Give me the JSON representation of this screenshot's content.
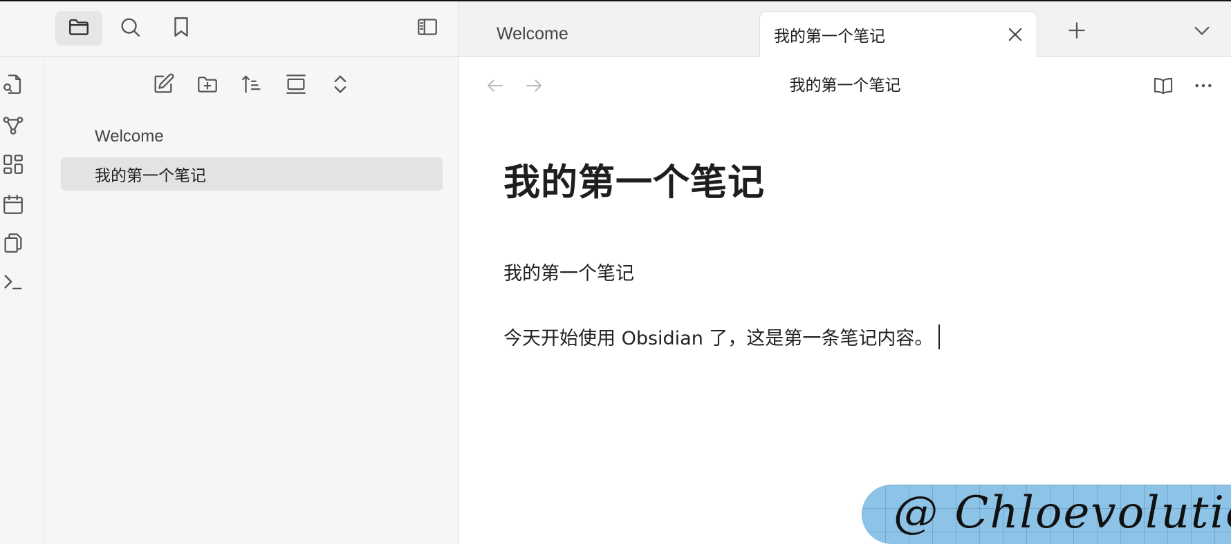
{
  "left_toolbar": {
    "icons": [
      "folder-icon",
      "search-icon",
      "bookmark-icon",
      "sidebar-toggle-icon"
    ]
  },
  "ribbon": {
    "icons": [
      "file-search-icon",
      "graph-icon",
      "canvas-icon",
      "calendar-icon",
      "copy-icon",
      "terminal-icon"
    ]
  },
  "explorer": {
    "tools": [
      "new-note-icon",
      "new-folder-icon",
      "sort-icon",
      "collapse-view-icon",
      "expand-collapse-icon"
    ],
    "files": [
      {
        "label": "Welcome",
        "active": false
      },
      {
        "label": "我的第一个笔记",
        "active": true
      }
    ]
  },
  "tabs": {
    "items": [
      {
        "label": "Welcome",
        "active": false
      },
      {
        "label": "我的第一个笔记",
        "active": true
      }
    ],
    "new_tab_icon": "plus-icon",
    "tab_list_icon": "chevron-down-icon"
  },
  "view": {
    "title": "我的第一个笔记",
    "back_icon": "arrow-left-icon",
    "forward_icon": "arrow-right-icon",
    "reading_view_icon": "book-open-icon",
    "more_icon": "more-options-icon"
  },
  "note": {
    "heading": "我的第一个笔记",
    "line1": "我的第一个笔记",
    "line2": "今天开始使用 Obsidian 了，这是第一条笔记内容。"
  },
  "watermark": {
    "text": "@ Chloevolution"
  }
}
